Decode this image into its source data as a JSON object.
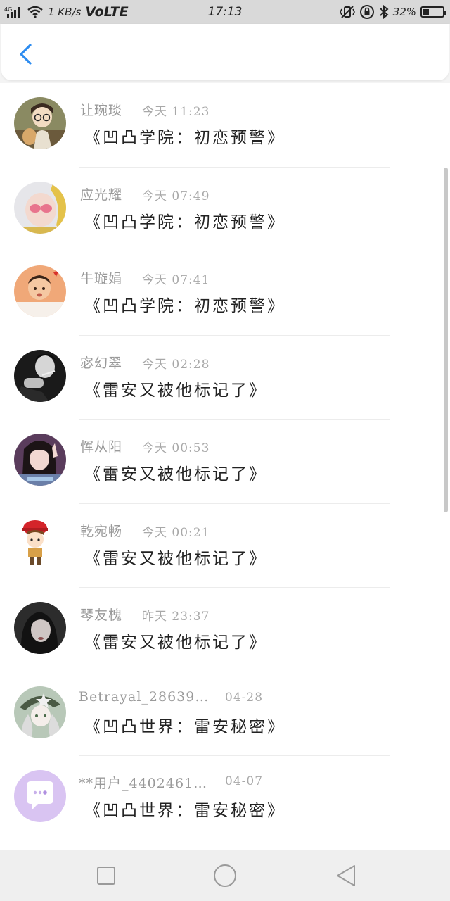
{
  "status_bar": {
    "network": "4G",
    "speed": "1 KB/s",
    "volte": "VoLTE",
    "time": "17:13",
    "battery_percent": "32%",
    "battery_level": 0.32
  },
  "header": {
    "back_icon": "chevron-left-icon",
    "accent_color": "#2d8cf0"
  },
  "items": [
    {
      "username": "让琬琰",
      "time": "今天 11:23",
      "title": "《凹凸学院：初恋预警》",
      "avatar": "avatar-glasses-boy-dog"
    },
    {
      "username": "应光耀",
      "time": "今天 07:49",
      "title": "《凹凸学院：初恋预警》",
      "avatar": "avatar-pink-sunglasses"
    },
    {
      "username": "牛璇娟",
      "time": "今天 07:41",
      "title": "《凹凸学院：初恋预警》",
      "avatar": "avatar-baby"
    },
    {
      "username": "宓幻翠",
      "time": "今天 02:28",
      "title": "《雷安又被他标记了》",
      "avatar": "avatar-bw-smoking"
    },
    {
      "username": "恽从阳",
      "time": "今天 00:53",
      "title": "《雷安又被他标记了》",
      "avatar": "avatar-girl-peace-sign"
    },
    {
      "username": "乾宛畅",
      "time": "今天 00:21",
      "title": "《雷安又被他标记了》",
      "avatar": "avatar-chibi-red-hat"
    },
    {
      "username": "琴友槐",
      "time": "昨天 23:37",
      "title": "《雷安又被他标记了》",
      "avatar": "avatar-dark-girl"
    },
    {
      "username": "Betrayal_28639…",
      "time": "04-28",
      "title": "《凹凸世界：雷安秘密》",
      "avatar": "avatar-anime-soldier"
    },
    {
      "username": "**用户_4402461…",
      "time": "04-07",
      "title": "《凹凸世界：雷安秘密》",
      "avatar": "avatar-purple-chat-bubble"
    }
  ],
  "nav_bar": {
    "recents_icon": "square-icon",
    "home_icon": "circle-icon",
    "back_icon": "triangle-back-icon"
  }
}
